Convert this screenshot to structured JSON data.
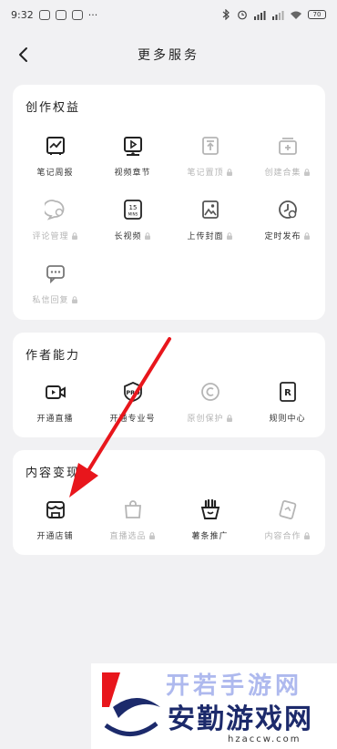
{
  "status_bar": {
    "time": "9:32",
    "battery": "70"
  },
  "header": {
    "title": "更多服务"
  },
  "sections": [
    {
      "title": "创作权益",
      "items": [
        {
          "label": "笔记周报",
          "icon": "report-icon",
          "locked": false
        },
        {
          "label": "视频章节",
          "icon": "video-chapter-icon",
          "locked": false
        },
        {
          "label": "笔记置顶",
          "icon": "pin-top-icon",
          "locked": true
        },
        {
          "label": "创建合集",
          "icon": "collection-icon",
          "locked": true
        },
        {
          "label": "评论管理",
          "icon": "comment-icon",
          "locked": true
        },
        {
          "label": "长视频",
          "icon": "long-video-icon",
          "locked": true
        },
        {
          "label": "上传封面",
          "icon": "cover-image-icon",
          "locked": true
        },
        {
          "label": "定时发布",
          "icon": "timer-icon",
          "locked": true
        },
        {
          "label": "私信回复",
          "icon": "message-icon",
          "locked": true
        }
      ]
    },
    {
      "title": "作者能力",
      "items": [
        {
          "label": "开通直播",
          "icon": "live-camera-icon",
          "locked": false
        },
        {
          "label": "开通专业号",
          "icon": "pro-badge-icon",
          "locked": false
        },
        {
          "label": "原创保护",
          "icon": "copyright-icon",
          "locked": true
        },
        {
          "label": "规则中心",
          "icon": "rules-icon",
          "locked": false
        }
      ]
    },
    {
      "title": "内容变现",
      "items": [
        {
          "label": "开通店铺",
          "icon": "shop-icon",
          "locked": false
        },
        {
          "label": "直播选品",
          "icon": "shopping-bag-icon",
          "locked": true
        },
        {
          "label": "薯条推广",
          "icon": "fries-icon",
          "locked": false
        },
        {
          "label": "内容合作",
          "icon": "cooperation-icon",
          "locked": true
        }
      ]
    }
  ],
  "icon_labels": {
    "long_video": "15\nMINS",
    "pro": "PRO",
    "rules": "R"
  },
  "colors": {
    "arrow": "#e8161c",
    "locked_gray": "#b5b5b5",
    "watermark_navy": "#1c2a6b"
  },
  "watermark": {
    "top_text": "开若手游网",
    "main_text": "安勤游戏网",
    "url": "hzaccw.com"
  }
}
